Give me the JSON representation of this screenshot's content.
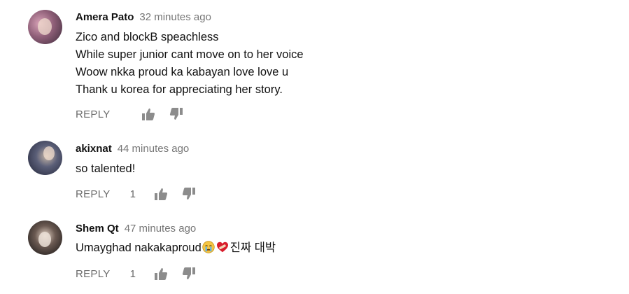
{
  "comments": [
    {
      "author": "Amera Pato",
      "time": "32 minutes ago",
      "lines": [
        "Zico and blockB speachless",
        "While super junior cant move on to her voice",
        "Woow nkka proud ka kabayan love love u",
        "Thank u korea for appreciating her story."
      ],
      "reply_label": "REPLY",
      "likes": ""
    },
    {
      "author": "akixnat",
      "time": "44 minutes ago",
      "lines": [
        "so talented!"
      ],
      "reply_label": "REPLY",
      "likes": "1"
    },
    {
      "author": "Shem Qt",
      "time": "47 minutes ago",
      "text_before_emoji": "Umayghad nakakaproud",
      "emojis": [
        "crying-face-icon",
        "heart-with-bandage-icon"
      ],
      "text_after_emoji": "진짜 대박",
      "reply_label": "REPLY",
      "likes": "1"
    }
  ],
  "colors": {
    "author": "#111111",
    "timestamp": "#767676",
    "action": "#6b6b6b",
    "icon": "#8c8c8c"
  }
}
